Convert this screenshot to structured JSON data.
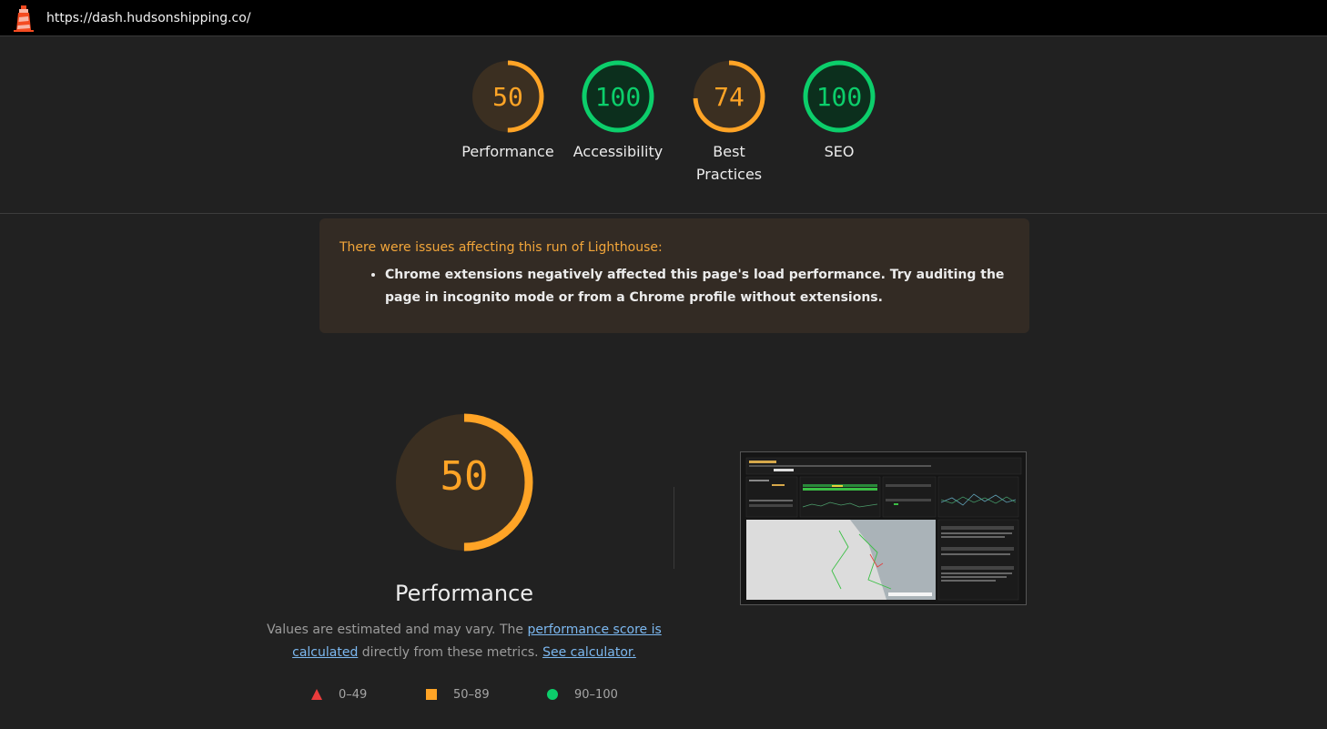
{
  "topbar": {
    "url": "https://dash.hudsonshipping.co/"
  },
  "scores": [
    {
      "label": "Performance",
      "value": 50,
      "fraction": 0.5,
      "status": "average"
    },
    {
      "label": "Accessibility",
      "value": 100,
      "fraction": 1.0,
      "status": "pass"
    },
    {
      "label": "Best Practices",
      "value": 74,
      "fraction": 0.74,
      "status": "average"
    },
    {
      "label": "SEO",
      "value": 100,
      "fraction": 1.0,
      "status": "pass"
    }
  ],
  "warning": {
    "title": "There were issues affecting this run of Lighthouse:",
    "items": [
      "Chrome extensions negatively affected this page's load performance. Try auditing the page in incognito mode or from a Chrome profile without extensions."
    ]
  },
  "performance": {
    "score": "50",
    "fraction": 0.5,
    "label": "Performance",
    "desc_prefix": "Values are estimated and may vary. The",
    "link_score": "performance score is calculated",
    "desc_middle": "directly from these metrics.",
    "link_calc": "See calculator."
  },
  "legend": [
    {
      "shape": "triangle",
      "range": "0–49",
      "color": "#eb3c3c"
    },
    {
      "shape": "square",
      "range": "50–89",
      "color": "#ffa426"
    },
    {
      "shape": "circle",
      "range": "90–100",
      "color": "#0cce6b"
    }
  ],
  "colors": {
    "pass": "#0cce6b",
    "pass_bg": "#0c2f1d",
    "average": "#ffa426",
    "average_bg": "#3b2f21",
    "fail": "#eb3c3c"
  }
}
